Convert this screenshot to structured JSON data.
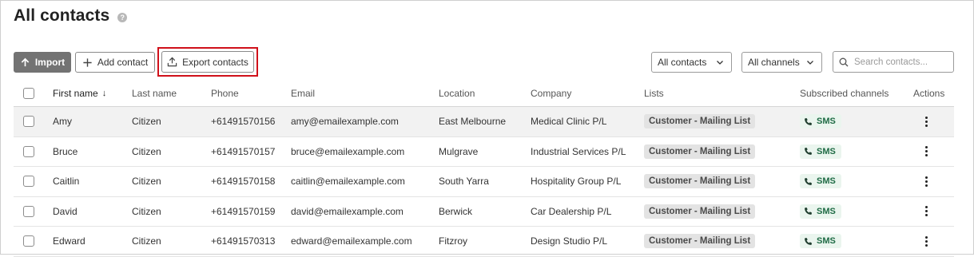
{
  "page": {
    "title": "All contacts",
    "help_icon": "?"
  },
  "toolbar": {
    "import_label": "Import",
    "add_label": "Add contact",
    "export_label": "Export contacts",
    "filter_contacts": "All contacts",
    "filter_channels": "All channels",
    "search_placeholder": "Search contacts..."
  },
  "colors": {
    "import_bg": "#737373",
    "highlight": "#d0101a",
    "sms_text": "#1f6b45",
    "sms_bg": "#eaf5ee",
    "list_badge_bg": "#e3e3e3"
  },
  "icons": {
    "import": "arrow-up-icon",
    "add": "plus-icon",
    "export": "upload-icon",
    "dropdown": "chevron-down-icon",
    "search": "search-icon",
    "sms": "phone-icon",
    "actions": "kebab-menu-icon",
    "sort": "arrow-down-icon"
  },
  "table": {
    "columns": {
      "first_name": "First name",
      "last_name": "Last name",
      "phone": "Phone",
      "email": "Email",
      "location": "Location",
      "company": "Company",
      "lists": "Lists",
      "subscribed": "Subscribed channels",
      "actions": "Actions"
    },
    "sort_indicator": "↓",
    "rows": [
      {
        "first": "Amy",
        "last": "Citizen",
        "phone": "+61491570156",
        "email": "amy@emailexample.com",
        "location": "East Melbourne",
        "company": "Medical Clinic P/L",
        "list": "Customer - Mailing List",
        "channel": "SMS"
      },
      {
        "first": "Bruce",
        "last": "Citizen",
        "phone": "+61491570157",
        "email": "bruce@emailexample.com",
        "location": "Mulgrave",
        "company": "Industrial Services P/L",
        "list": "Customer - Mailing List",
        "channel": "SMS"
      },
      {
        "first": "Caitlin",
        "last": "Citizen",
        "phone": "+61491570158",
        "email": "caitlin@emailexample.com",
        "location": "South Yarra",
        "company": "Hospitality Group P/L",
        "list": "Customer - Mailing List",
        "channel": "SMS"
      },
      {
        "first": "David",
        "last": "Citizen",
        "phone": "+61491570159",
        "email": "david@emailexample.com",
        "location": "Berwick",
        "company": "Car Dealership P/L",
        "list": "Customer - Mailing List",
        "channel": "SMS"
      },
      {
        "first": "Edward",
        "last": "Citizen",
        "phone": "+61491570313",
        "email": "edward@emailexample.com",
        "location": "Fitzroy",
        "company": "Design Studio P/L",
        "list": "Customer - Mailing List",
        "channel": "SMS"
      }
    ]
  }
}
